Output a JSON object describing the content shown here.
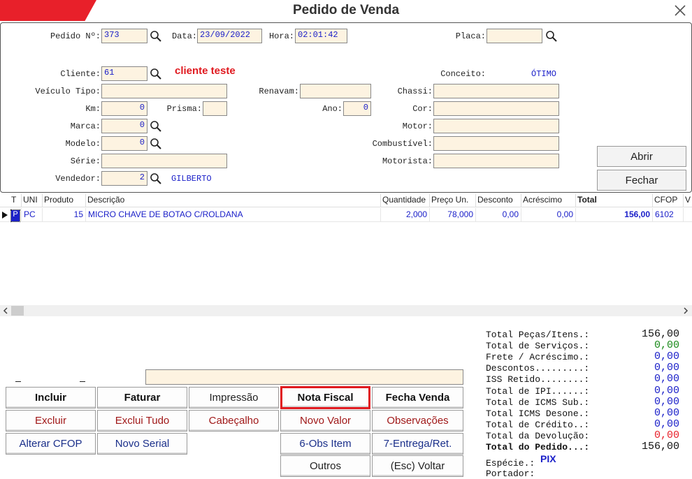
{
  "window": {
    "title": "Pedido de Venda"
  },
  "header": {
    "pedido_label": "Pedido Nº:",
    "pedido_value": "373",
    "data_label": "Data:",
    "data_value": "23/09/2022",
    "hora_label": "Hora:",
    "hora_value": "02:01:42",
    "placa_label": "Placa:",
    "placa_value": "",
    "cliente_label": "Cliente:",
    "cliente_value": "61",
    "cliente_name": "cliente teste",
    "conceito_label": "Conceito:",
    "conceito_value": "ÓTIMO",
    "veiculo_tipo_label": "Veículo Tipo:",
    "veiculo_tipo_value": "",
    "renavam_label": "Renavam:",
    "renavam_value": "",
    "chassi_label": "Chassi:",
    "chassi_value": "",
    "km_label": "Km:",
    "km_value": "0",
    "prisma_label": "Prisma:",
    "prisma_value": "",
    "ano_label": "Ano:",
    "ano_value": "0",
    "cor_label": "Cor:",
    "cor_value": "",
    "marca_label": "Marca:",
    "marca_value": "0",
    "motor_label": "Motor:",
    "motor_value": "",
    "modelo_label": "Modelo:",
    "modelo_value": "0",
    "combustivel_label": "Combustível:",
    "combustivel_value": "",
    "serie_label": "Série:",
    "serie_value": "",
    "motorista_label": "Motorista:",
    "motorista_value": "",
    "vendedor_label": "Vendedor:",
    "vendedor_value": "2",
    "vendedor_name": "GILBERTO",
    "abrir_label": "Abrir",
    "fechar_label": "Fechar"
  },
  "grid": {
    "columns": [
      "T",
      "UNI",
      "Produto",
      "Descrição",
      "Quantidade",
      "Preço Un.",
      "Desconto",
      "Acréscimo",
      "Total",
      "CFOP",
      "V"
    ],
    "rows": [
      {
        "t": "P",
        "uni": "PC",
        "produto": "15",
        "descricao": "MICRO CHAVE DE BOTAO C/ROLDANA",
        "quantidade": "2,000",
        "preco": "78,000",
        "desconto": "0,00",
        "acrescimo": "0,00",
        "total": "156,00",
        "cfop": "6102"
      }
    ]
  },
  "buttons": {
    "incluir": "Incluir",
    "faturar": "Faturar",
    "impressao": "Impressão",
    "nota_fiscal": "Nota Fiscal",
    "fecha_venda": "Fecha Venda",
    "excluir": "Excluir",
    "exclui_tudo": "Exclui Tudo",
    "cabecalho": "Cabeçalho",
    "novo_valor": "Novo Valor",
    "observacoes": "Observações",
    "alterar_cfop": "Alterar CFOP",
    "novo_serial": "Novo Serial",
    "obs_item": "6-Obs Item",
    "entrega": "7-Entrega/Ret.",
    "outros": "Outros",
    "voltar": "(Esc) Voltar"
  },
  "totals": {
    "items": [
      {
        "label": "Total Peças/Itens.:",
        "value": "156,00",
        "color": "#111111"
      },
      {
        "label": "Total de Serviços.:",
        "value": "0,00",
        "color": "#1a8a1a"
      },
      {
        "label": "Frete / Acréscimo.:",
        "value": "0,00",
        "color": "#1b20c9"
      },
      {
        "label": "Descontos.........:",
        "value": "0,00",
        "color": "#1b20c9"
      },
      {
        "label": "ISS Retido........:",
        "value": "0,00",
        "color": "#1b20c9"
      },
      {
        "label": "Total de IPI......:",
        "value": "0,00",
        "color": "#1b20c9"
      },
      {
        "label": "Total de ICMS Sub.:",
        "value": "0,00",
        "color": "#1b20c9"
      },
      {
        "label": "Total ICMS Desone.:",
        "value": "0,00",
        "color": "#1b20c9"
      },
      {
        "label": "Total de Crédito..:",
        "value": "0,00",
        "color": "#1b20c9"
      },
      {
        "label": "Total da Devolução:",
        "value": "0,00",
        "color": "#e8202a"
      },
      {
        "label": "Total do Pedido...:",
        "value": "156,00",
        "color": "#111111"
      }
    ],
    "especie_label": "Espécie.:",
    "especie_value": "PIX",
    "portador_label": "Portador:"
  },
  "colors": {
    "accent_red": "#e8202a",
    "field_bg": "#fdf3e1",
    "value_blue": "#1b20c9",
    "highlight": "#e0191f"
  }
}
